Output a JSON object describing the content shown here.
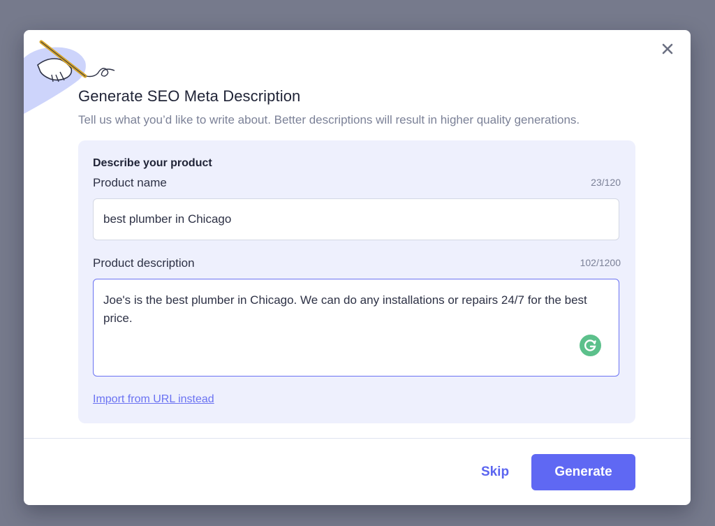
{
  "dialog": {
    "title": "Generate SEO Meta Description",
    "subtitle": "Tell us what you’d like to write about. Better descriptions will result in higher quality generations."
  },
  "form": {
    "section_heading": "Describe your product",
    "product_name": {
      "label": "Product name",
      "counter": "23/120",
      "value": "best plumber in Chicago"
    },
    "product_description": {
      "label": "Product description",
      "counter": "102/1200",
      "value": "Joe's is the best plumber in Chicago.  We can do any installations or repairs 24/7 for the best price."
    },
    "import_link": "Import from URL instead"
  },
  "footer": {
    "skip_label": "Skip",
    "generate_label": "Generate"
  },
  "icons": {
    "close": "close-icon",
    "illustration": "hand-writing-pen-illustration",
    "grammarly": "grammarly-icon"
  },
  "colors": {
    "accent": "#5f68f3",
    "panel_background": "#eef0fd",
    "backdrop": "#767a8c",
    "grammarly": "#5cc08b"
  }
}
